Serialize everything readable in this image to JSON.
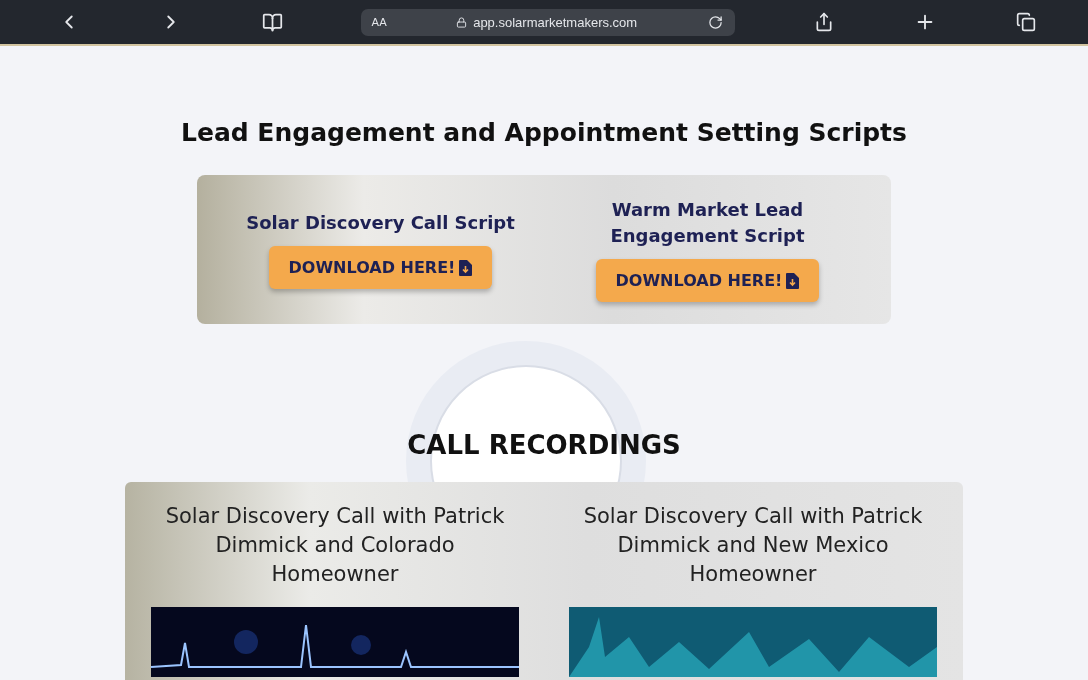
{
  "browser": {
    "text_size_label": "AA",
    "url": "app.solarmarketmakers.com"
  },
  "scripts_section": {
    "title": "Lead Engagement and Appointment Setting Scripts",
    "scripts": [
      {
        "title": "Solar Discovery Call Script",
        "button": "DOWNLOAD HERE!"
      },
      {
        "title": "Warm Market Lead Engagement Script",
        "button": "DOWNLOAD HERE!"
      }
    ]
  },
  "recordings_section": {
    "title": "CALL RECORDINGS",
    "recordings": [
      {
        "title": "Solar Discovery Call with Patrick Dimmick and Colorado Homeowner",
        "kind": "dark"
      },
      {
        "title": "Solar Discovery Call with Patrick Dimmick and New Mexico Homeowner",
        "kind": "teal"
      }
    ]
  }
}
